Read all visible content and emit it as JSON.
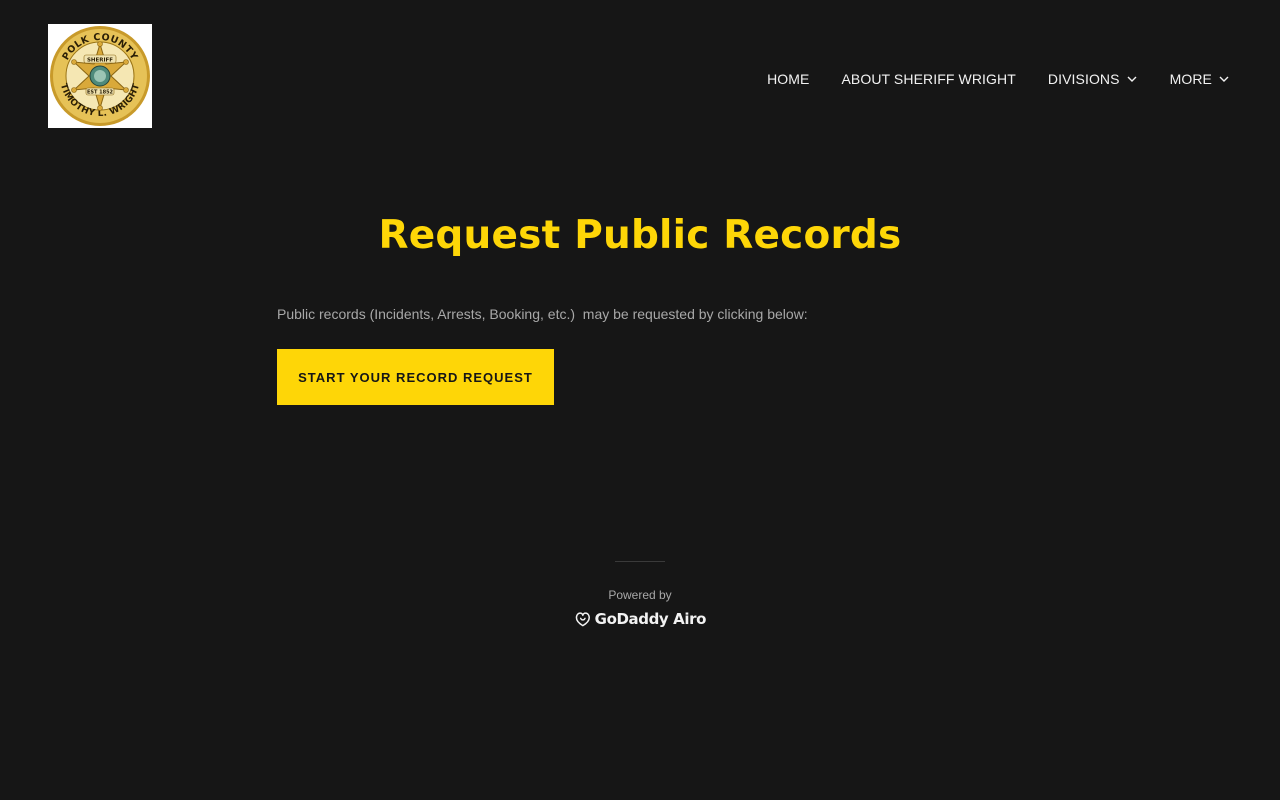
{
  "logo": {
    "top_text": "POLK COUNTY",
    "bottom_text": "TIMOTHY L. WRIGHT",
    "star_banner": "SHERIFF",
    "est_text": "EST 1852",
    "icon": "sheriff-badge-logo"
  },
  "nav": {
    "items": [
      {
        "label": "HOME",
        "has_dropdown": false
      },
      {
        "label": "ABOUT SHERIFF WRIGHT",
        "has_dropdown": false
      },
      {
        "label": "DIVISIONS",
        "has_dropdown": true
      },
      {
        "label": "MORE",
        "has_dropdown": true
      }
    ],
    "dropdown_icon": "chevron-down-icon"
  },
  "main": {
    "title": "Request Public Records",
    "description": "Public records (Incidents, Arrests, Booking, etc.)  may be requested by clicking below:",
    "cta_label": "START YOUR RECORD REQUEST"
  },
  "footer": {
    "powered_by": "Powered by",
    "brand": "GoDaddy Airo",
    "brand_icon": "godaddy-logo-icon"
  },
  "colors": {
    "background": "#161616",
    "accent": "#fed607",
    "nav_text": "#f2f2f2",
    "body_text": "#a8a8a8"
  }
}
